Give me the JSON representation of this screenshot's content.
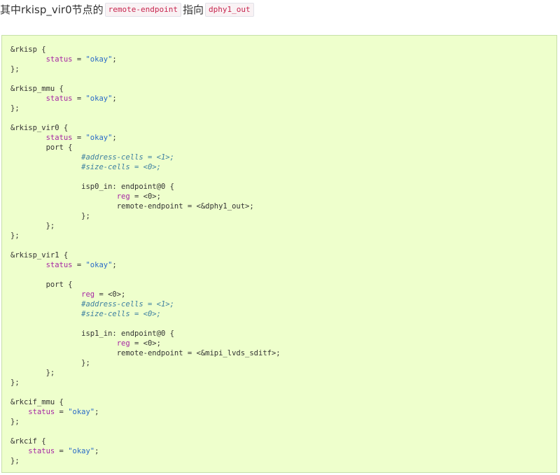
{
  "intro": {
    "prefix": "其中rkisp_vir0节点的",
    "code1": "remote-endpoint",
    "middle": "指向",
    "code2": "dphy1_out"
  },
  "code": {
    "lines": [
      [
        {
          "t": "&rkisp {",
          "k": "plain"
        }
      ],
      [
        {
          "t": "\t",
          "k": "plain"
        },
        {
          "t": "status",
          "k": "prop"
        },
        {
          "t": " = ",
          "k": "plain"
        },
        {
          "t": "\"okay\"",
          "k": "str"
        },
        {
          "t": ";",
          "k": "plain"
        }
      ],
      [
        {
          "t": "};",
          "k": "plain"
        }
      ],
      [],
      [
        {
          "t": "&rkisp_mmu {",
          "k": "plain"
        }
      ],
      [
        {
          "t": "\t",
          "k": "plain"
        },
        {
          "t": "status",
          "k": "prop"
        },
        {
          "t": " = ",
          "k": "plain"
        },
        {
          "t": "\"okay\"",
          "k": "str"
        },
        {
          "t": ";",
          "k": "plain"
        }
      ],
      [
        {
          "t": "};",
          "k": "plain"
        }
      ],
      [],
      [
        {
          "t": "&rkisp_vir0 {",
          "k": "plain"
        }
      ],
      [
        {
          "t": "\t",
          "k": "plain"
        },
        {
          "t": "status",
          "k": "prop"
        },
        {
          "t": " = ",
          "k": "plain"
        },
        {
          "t": "\"okay\"",
          "k": "str"
        },
        {
          "t": ";",
          "k": "plain"
        }
      ],
      [
        {
          "t": "\tport {",
          "k": "plain"
        }
      ],
      [
        {
          "t": "\t\t",
          "k": "plain"
        },
        {
          "t": "#address-cells = <1>;",
          "k": "comment"
        }
      ],
      [
        {
          "t": "\t\t",
          "k": "plain"
        },
        {
          "t": "#size-cells = <0>;",
          "k": "comment"
        }
      ],
      [],
      [
        {
          "t": "\t\tisp0_in: endpoint@0 {",
          "k": "plain"
        }
      ],
      [
        {
          "t": "\t\t\t",
          "k": "plain"
        },
        {
          "t": "reg",
          "k": "prop"
        },
        {
          "t": " = <0>;",
          "k": "plain"
        }
      ],
      [
        {
          "t": "\t\t\tremote-endpoint = <&dphy1_out>;",
          "k": "plain"
        }
      ],
      [
        {
          "t": "\t\t};",
          "k": "plain"
        }
      ],
      [
        {
          "t": "\t};",
          "k": "plain"
        }
      ],
      [
        {
          "t": "};",
          "k": "plain"
        }
      ],
      [],
      [
        {
          "t": "&rkisp_vir1 {",
          "k": "plain"
        }
      ],
      [
        {
          "t": "\t",
          "k": "plain"
        },
        {
          "t": "status",
          "k": "prop"
        },
        {
          "t": " = ",
          "k": "plain"
        },
        {
          "t": "\"okay\"",
          "k": "str"
        },
        {
          "t": ";",
          "k": "plain"
        }
      ],
      [],
      [
        {
          "t": "\tport {",
          "k": "plain"
        }
      ],
      [
        {
          "t": "\t\t",
          "k": "plain"
        },
        {
          "t": "reg",
          "k": "prop"
        },
        {
          "t": " = <0>;",
          "k": "plain"
        }
      ],
      [
        {
          "t": "\t\t",
          "k": "plain"
        },
        {
          "t": "#address-cells = <1>;",
          "k": "comment"
        }
      ],
      [
        {
          "t": "\t\t",
          "k": "plain"
        },
        {
          "t": "#size-cells = <0>;",
          "k": "comment"
        }
      ],
      [],
      [
        {
          "t": "\t\tisp1_in: endpoint@0 {",
          "k": "plain"
        }
      ],
      [
        {
          "t": "\t\t\t",
          "k": "plain"
        },
        {
          "t": "reg",
          "k": "prop"
        },
        {
          "t": " = <0>;",
          "k": "plain"
        }
      ],
      [
        {
          "t": "\t\t\tremote-endpoint = <&mipi_lvds_sditf>;",
          "k": "plain"
        }
      ],
      [
        {
          "t": "\t\t};",
          "k": "plain"
        }
      ],
      [
        {
          "t": "\t};",
          "k": "plain"
        }
      ],
      [
        {
          "t": "};",
          "k": "plain"
        }
      ],
      [],
      [
        {
          "t": "&rkcif_mmu {",
          "k": "plain"
        }
      ],
      [
        {
          "t": "    ",
          "k": "plain"
        },
        {
          "t": "status",
          "k": "prop"
        },
        {
          "t": " = ",
          "k": "plain"
        },
        {
          "t": "\"okay\"",
          "k": "str"
        },
        {
          "t": ";",
          "k": "plain"
        }
      ],
      [
        {
          "t": "};",
          "k": "plain"
        }
      ],
      [],
      [
        {
          "t": "&rkcif {",
          "k": "plain"
        }
      ],
      [
        {
          "t": "    ",
          "k": "plain"
        },
        {
          "t": "status",
          "k": "prop"
        },
        {
          "t": " = ",
          "k": "plain"
        },
        {
          "t": "\"okay\"",
          "k": "str"
        },
        {
          "t": ";",
          "k": "plain"
        }
      ],
      [
        {
          "t": "};",
          "k": "plain"
        }
      ]
    ]
  }
}
